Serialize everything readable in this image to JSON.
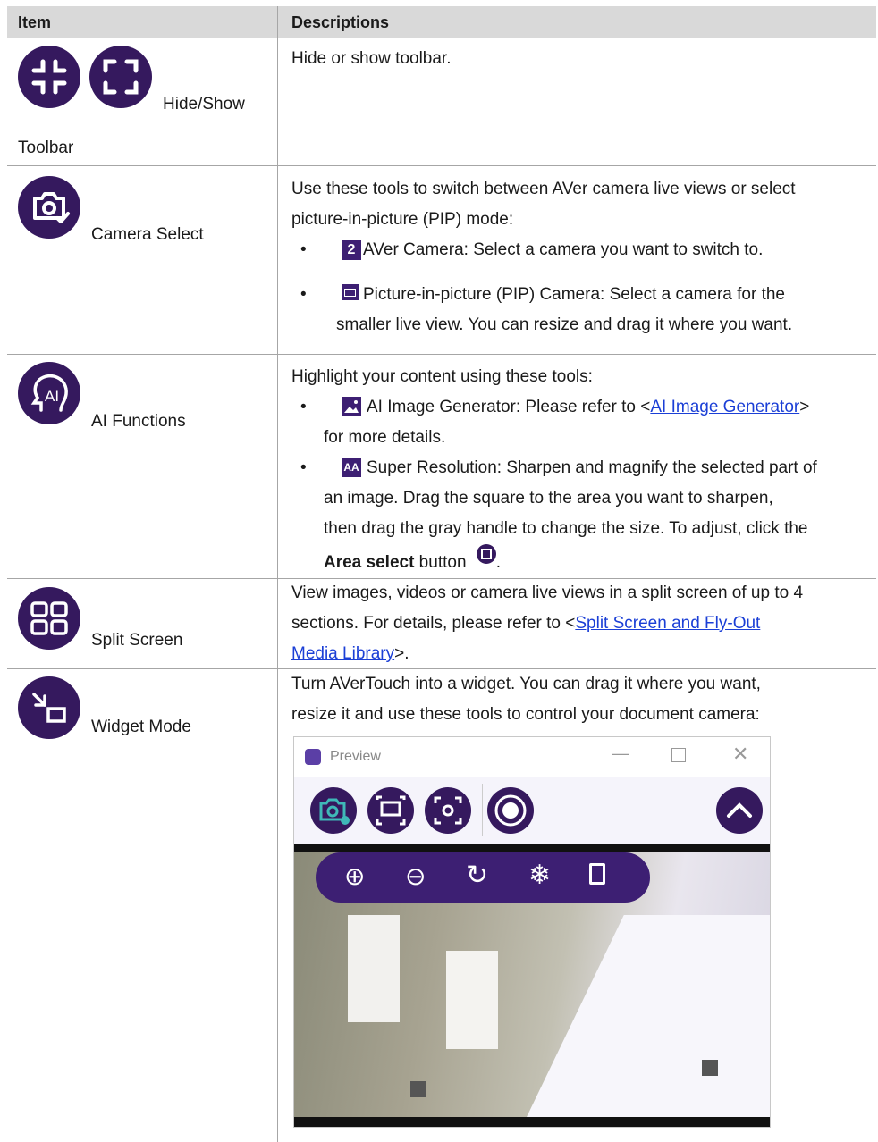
{
  "header": {
    "item": "Item",
    "descriptions": "Descriptions"
  },
  "rows": [
    {
      "label_line1": "Hide/Show",
      "label_line2": "Toolbar",
      "desc": "Hide or show toolbar."
    },
    {
      "label": "Camera Select",
      "desc_line1": "Use these tools to switch between AVer camera live views or select",
      "desc_line2": "picture-in-picture (PIP) mode:",
      "bullet1": "AVer Camera: Select a camera you want to switch to.",
      "bullet2_line1": "Picture-in-picture (PIP) Camera: Select a camera for the",
      "bullet2_line2": "smaller live view. You can resize and drag it where you want."
    },
    {
      "label": "AI Functions",
      "desc": "Highlight your content using these tools:",
      "b1_pre": "AI Image Generator: Please refer to <",
      "b1_link": "AI Image Generator",
      "b1_post": ">",
      "b1_line2": "for more details.",
      "b2_line1": "Super Resolution: Sharpen and magnify the selected part of",
      "b2_line2": "an image. Drag the square to the area you want to sharpen,",
      "b2_line3": "then drag the gray handle to change the size. To adjust, click the",
      "b2_bold": "Area select",
      "b2_after": " button",
      "b2_end": "."
    },
    {
      "label": "Split Screen",
      "line1": "View images, videos or camera live views in a split screen of up to 4",
      "line2_pre": "sections. For details, please refer to <",
      "link_a": "Split Screen and Fly-Out",
      "link_b": "Media Library",
      "line3_post": ">."
    },
    {
      "label": "Widget Mode",
      "line1": "Turn AVerTouch into a widget. You can drag it where you want,",
      "line2": "resize it and use these tools to control your document camera:"
    }
  ],
  "preview": {
    "title": "Preview",
    "icons": [
      "camera-settings-icon",
      "screen-capture-icon",
      "camera-capture-icon",
      "record-icon",
      "collapse-up-icon",
      "zoom-in-icon",
      "zoom-out-icon",
      "rotate-icon",
      "freeze-icon",
      "rotate-frame-icon"
    ]
  },
  "colors": {
    "icon_bg": "#35195e",
    "accent": "#3d1f73",
    "link": "#1b3fd6",
    "header_bg": "#d9d9d9"
  }
}
